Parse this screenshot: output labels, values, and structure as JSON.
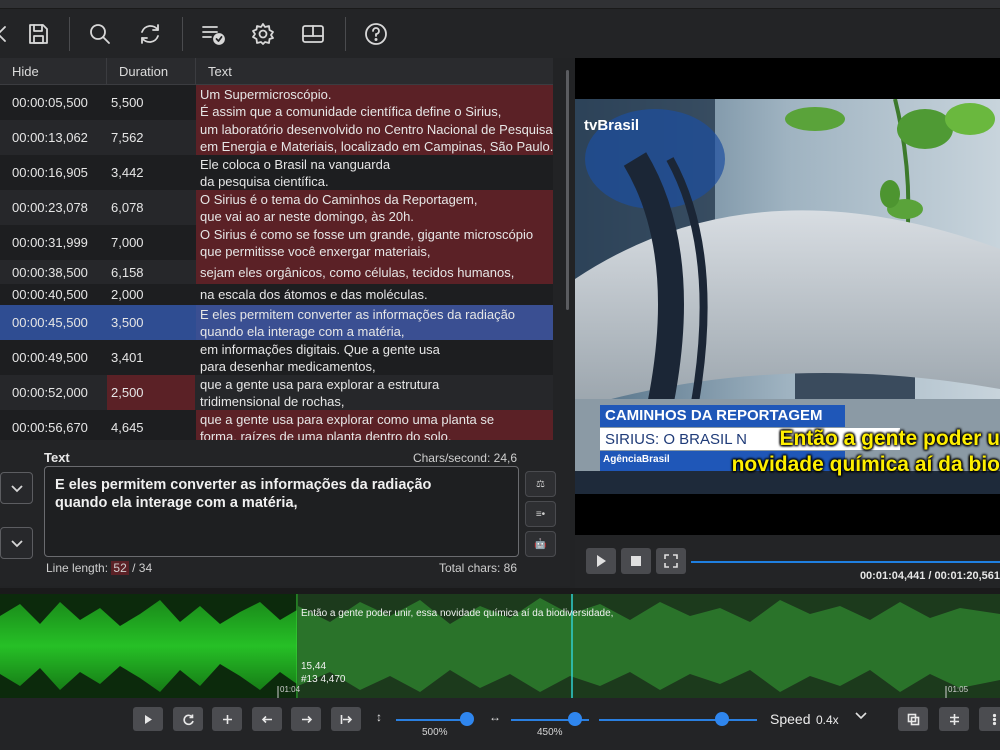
{
  "table": {
    "headers": {
      "hide": "Hide",
      "duration": "Duration",
      "text": "Text"
    },
    "rows": [
      {
        "hide": "00:00:05,500",
        "duration": "5,500",
        "line1": "Um Supermicroscópio.",
        "line2": "É assim que a comunidade científica define o Sirius,"
      },
      {
        "hide": "00:00:13,062",
        "duration": "7,562",
        "line1": "um laboratório desenvolvido no Centro Nacional de Pesquisa",
        "line2": "em Energia e Materiais, localizado em Campinas, São Paulo."
      },
      {
        "hide": "00:00:16,905",
        "duration": "3,442",
        "line1": "Ele coloca o Brasil na vanguarda",
        "line2": "da pesquisa científica."
      },
      {
        "hide": "00:00:23,078",
        "duration": "6,078",
        "line1": "O Sirius é o tema do Caminhos da Reportagem,",
        "line2": "que vai ao ar neste domingo, às 20h."
      },
      {
        "hide": "00:00:31,999",
        "duration": "7,000",
        "line1": "O Sirius é como se fosse um grande, gigante microscópio",
        "line2": "que permitisse você enxergar materiais,"
      },
      {
        "hide": "00:00:38,500",
        "duration": "6,158",
        "line1": "sejam eles orgânicos, como células, tecidos humanos,",
        "line2": ""
      },
      {
        "hide": "00:00:40,500",
        "duration": "2,000",
        "line1": "na escala dos átomos e das moléculas.",
        "line2": ""
      },
      {
        "hide": "00:00:45,500",
        "duration": "3,500",
        "line1": "E eles permitem converter as informações da radiação",
        "line2": "quando ela interage com a matéria,"
      },
      {
        "hide": "00:00:49,500",
        "duration": "3,401",
        "line1": "em informações digitais. Que a gente usa",
        "line2": "para desenhar medicamentos,"
      },
      {
        "hide": "00:00:52,000",
        "duration": "2,500",
        "line1": "que a gente usa para explorar a estrutura",
        "line2": "tridimensional de rochas,"
      },
      {
        "hide": "00:00:56,670",
        "duration": "4,645",
        "line1": "que a gente usa para explorar como uma planta se",
        "line2": "forma, raízes de uma planta dentro do solo,"
      }
    ]
  },
  "editor": {
    "label": "Text",
    "chars_per_second": "Chars/second: 24,6",
    "line1": "E eles permitem converter as informações da radiação",
    "line2": "quando ela interage com a matéria,",
    "line_length_label": "Line length:",
    "line_length_1": "52",
    "line_length_2": "/ 34",
    "total_chars": "Total chars: 86"
  },
  "video": {
    "channel_logo": "tvBrasil",
    "banner_title": "CAMINHOS DA REPORTAGEM",
    "banner_sub": "SIRIUS: O BRASIL N",
    "agency": "AgênciaBrasil",
    "subtitle_line1": "Então a gente poder u",
    "subtitle_line2": "novidade química aí da bio"
  },
  "player": {
    "time": "00:01:04,441 / 00:01:20,561"
  },
  "waveform": {
    "current_text": "Então a gente poder unir, essa novidade química aí da biodiversidade,",
    "duration_value": "15,44",
    "info": "#13  4,470",
    "tick_left": "01:04",
    "tick_right": "01:05"
  },
  "bottom": {
    "vzoom_label": "500%",
    "hzoom_label": "450%",
    "speed_label": "Speed",
    "speed_value": "0.4x"
  },
  "colors": {
    "selection": "#2f4d92",
    "error": "#5b2126",
    "accent": "#2f86ee",
    "subtitle": "#ffef00",
    "wave": "#1fb41f"
  }
}
